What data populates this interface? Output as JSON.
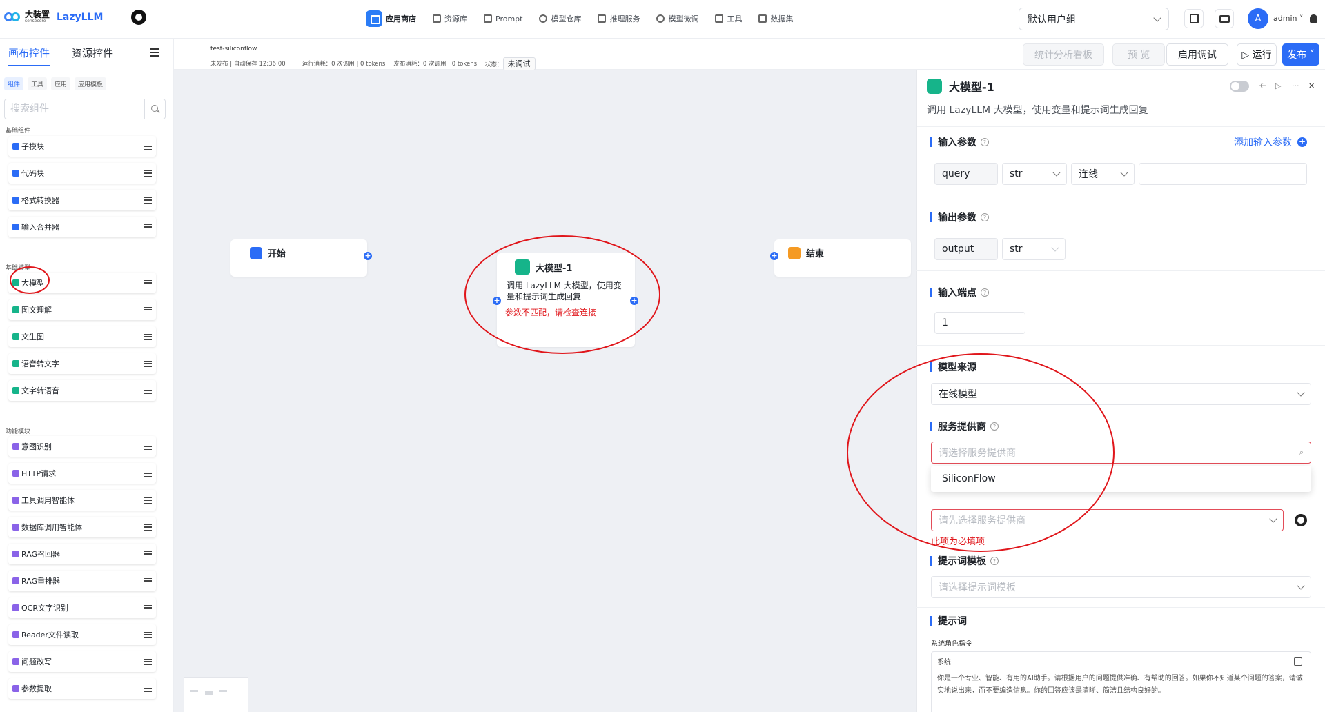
{
  "header": {
    "brand_cn": "大装置",
    "brand_sub": "sensecore",
    "brand_en": "LazyLLM",
    "nav": [
      {
        "label": "应用商店",
        "icon": "store-icon"
      },
      {
        "label": "资源库",
        "icon": "grid-icon"
      },
      {
        "label": "Prompt",
        "icon": "prompt-icon"
      },
      {
        "label": "模型仓库",
        "icon": "model-repo-icon"
      },
      {
        "label": "推理服务",
        "icon": "inference-icon"
      },
      {
        "label": "模型微调",
        "icon": "finetune-icon"
      },
      {
        "label": "工具",
        "icon": "tools-icon"
      },
      {
        "label": "数据集",
        "icon": "dataset-icon"
      }
    ],
    "user_group": "默认用户组",
    "avatar_letter": "A",
    "username": "admin"
  },
  "sidebar": {
    "tabs": [
      "画布控件",
      "资源控件"
    ],
    "chips": [
      "组件",
      "工具",
      "应用",
      "应用模板"
    ],
    "search_placeholder": "搜索组件",
    "groups": [
      {
        "label": "基础组件",
        "items": [
          "子模块",
          "代码块",
          "格式转换器",
          "输入合并器"
        ]
      },
      {
        "label": "基础模型",
        "items": [
          "大模型",
          "图文理解",
          "文生图",
          "语音转文字",
          "文字转语音"
        ]
      },
      {
        "label": "功能模块",
        "items": [
          "意图识别",
          "HTTP请求",
          "工具调用智能体",
          "数据库调用智能体",
          "RAG召回器",
          "RAG重排器",
          "OCR文字识别",
          "Reader文件读取",
          "问题改写",
          "参数提取"
        ]
      }
    ]
  },
  "canvas_header": {
    "workflow_name": "test-siliconflow",
    "save_status": "未发布 | 自动保存 12:36:00",
    "run_cost": "运行消耗：0 次调用 | 0 tokens",
    "publish_cost": "发布消耗：0 次调用 | 0 tokens",
    "status_label": "状态：",
    "status_value": "未调试",
    "buttons": {
      "stats": "统计分析看板",
      "preview": "预 览",
      "debug": "启用调试",
      "run": "▷ 运行",
      "publish": "发布"
    }
  },
  "canvas": {
    "start_node": "开始",
    "llm_node": {
      "title": "大模型-1",
      "desc": "调用 LazyLLM 大模型，使用变量和提示词生成回复",
      "error": "参数不匹配，请检查连接"
    },
    "end_node": "结束"
  },
  "panel": {
    "title": "大模型-1",
    "desc": "调用 LazyLLM 大模型，使用变量和提示词生成回复",
    "input_params": {
      "label": "输入参数",
      "add_label": "添加输入参数",
      "name": "query",
      "type": "str",
      "source": "连线"
    },
    "output_params": {
      "label": "输出参数",
      "name": "output",
      "type": "str"
    },
    "input_port": {
      "label": "输入端点",
      "value": "1"
    },
    "model_source": {
      "label": "模型来源",
      "value": "在线模型"
    },
    "provider": {
      "label": "服务提供商",
      "placeholder": "请选择服务提供商",
      "option": "SiliconFlow"
    },
    "model_name": {
      "placeholder": "请先选择服务提供商",
      "error": "此项为必填项"
    },
    "prompt_template": {
      "label": "提示词模板",
      "placeholder": "请选择提示词模板"
    },
    "prompt": {
      "label": "提示词",
      "sub_label": "系统角色指令",
      "role": "系统",
      "text": "你是一个专业、智能、有用的AI助手。请根据用户的问题提供准确、有帮助的回答。如果你不知道某个问题的答案，请诚实地说出来，而不要编造信息。你的回答应该是清晰、简洁且结构良好的。"
    }
  },
  "colors": {
    "accent": "#2b6cf6",
    "error": "#e0161b",
    "node_green": "#16b48a",
    "node_orange": "#f59a23"
  }
}
